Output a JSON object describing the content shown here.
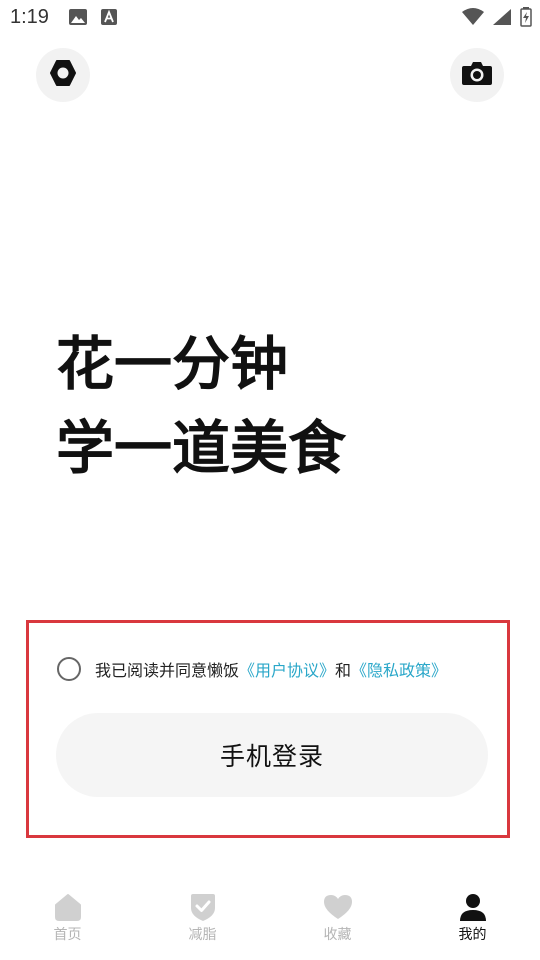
{
  "status_bar": {
    "time": "1:19",
    "icons": [
      "image-icon",
      "text-a-icon",
      "wifi-icon",
      "signal-icon",
      "battery-icon"
    ]
  },
  "top_actions": {
    "left_icon": "settings-icon",
    "right_icon": "camera-icon"
  },
  "headline": {
    "line1": "花一分钟",
    "line2": "学一道美食"
  },
  "agreement": {
    "prefix": "我已阅读并同意懒饭",
    "user_agreement": "《用户协议》",
    "conjunction": "和",
    "privacy_policy": "《隐私政策》",
    "checked": false
  },
  "login": {
    "phone_button": "手机登录"
  },
  "bottom_nav": {
    "items": [
      {
        "label": "首页",
        "icon": "home-icon",
        "active": false
      },
      {
        "label": "减脂",
        "icon": "shield-check-icon",
        "active": false
      },
      {
        "label": "收藏",
        "icon": "heart-icon",
        "active": false
      },
      {
        "label": "我的",
        "icon": "user-icon",
        "active": true
      }
    ]
  },
  "colors": {
    "link": "#2aa7c9",
    "highlight_border": "#d9383e",
    "inactive_nav": "#b5b5b5",
    "active_nav": "#111111"
  }
}
